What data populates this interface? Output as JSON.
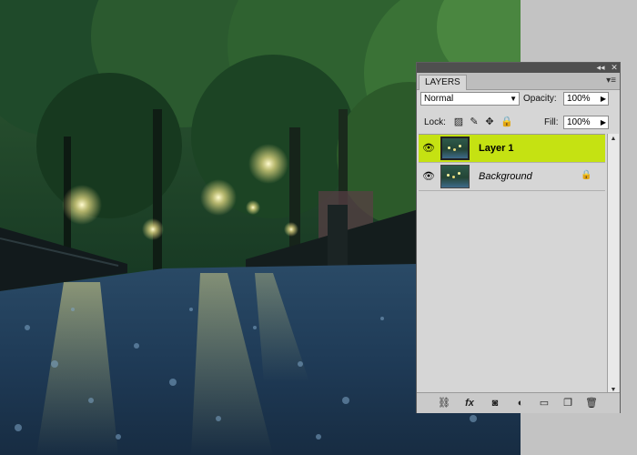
{
  "panel": {
    "tab_label": "LAYERS",
    "blend_mode": "Normal",
    "opacity_label": "Opacity:",
    "opacity_value": "100%",
    "lock_label": "Lock:",
    "fill_label": "Fill:",
    "fill_value": "100%",
    "collapse_icon": "double-chevron-icon",
    "close_icon": "close-icon",
    "menu_icon": "panel-menu-icon"
  },
  "layers": [
    {
      "name": "Layer 1",
      "visible": true,
      "selected": true,
      "locked": false
    },
    {
      "name": "Background",
      "visible": true,
      "selected": false,
      "locked": true
    }
  ],
  "footer_icons": [
    "link-layers-icon",
    "fx-icon",
    "add-mask-icon",
    "adjustment-layer-icon",
    "new-group-icon",
    "new-layer-icon",
    "delete-layer-icon"
  ],
  "colors": {
    "selected_row": "#c5e212",
    "panel_bg": "#d6d6d6",
    "titlebar": "#4f4f4f"
  }
}
